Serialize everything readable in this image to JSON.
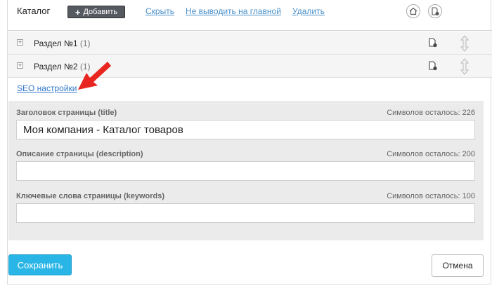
{
  "header": {
    "title": "Каталог",
    "add_label": "Добавить",
    "links": [
      "Скрыть",
      "Не выводить на главной",
      "Удалить"
    ],
    "home_icon": "home-icon",
    "settings_icon": "doc-settings-icon"
  },
  "sections": [
    {
      "label": "Раздел №1",
      "count": "(1)"
    },
    {
      "label": "Раздел №2",
      "count": "(1)"
    }
  ],
  "seo_link": "SEO настройки",
  "seo": {
    "title": {
      "label": "Заголовок страницы (title)",
      "remaining": "Символов осталось: 226",
      "value": "Моя компания - Каталог товаров"
    },
    "description": {
      "label": "Описание страницы (description)",
      "remaining": "Символов осталось: 200",
      "value": ""
    },
    "keywords": {
      "label": "Ключевые слова страницы (keywords)",
      "remaining": "Символов осталось: 100",
      "value": ""
    }
  },
  "buttons": {
    "save": "Сохранить",
    "cancel": "Отмена"
  },
  "colors": {
    "accent": "#29b6e6",
    "link": "#4a90c9",
    "arrow": "#e8261f"
  }
}
